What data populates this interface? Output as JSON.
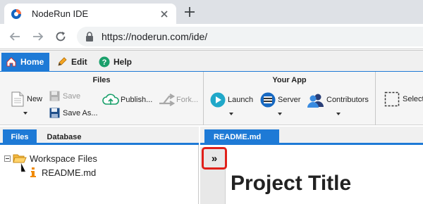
{
  "browser": {
    "tab_title": "NodeRun IDE",
    "url": "https://noderun.com/ide/",
    "icons": [
      "back-arrow-icon",
      "forward-arrow-icon",
      "reload-icon",
      "lock-icon",
      "close-icon",
      "plus-icon"
    ]
  },
  "menubar": {
    "home_label": "Home",
    "edit_label": "Edit",
    "help_label": "Help"
  },
  "ribbon": {
    "files_group": {
      "title": "Files",
      "new_label": "New",
      "save_label": "Save",
      "save_as_label": "Save As...",
      "publish_label": "Publish...",
      "fork_label": "Fork..."
    },
    "app_group": {
      "title": "Your App",
      "launch_label": "Launch",
      "server_label": "Server",
      "contributors_label": "Contributors"
    },
    "select_label": "Select"
  },
  "left_panel": {
    "tabs": [
      "Files",
      "Database"
    ],
    "tree": {
      "root_label": "Workspace Files",
      "file_label": "README.md"
    }
  },
  "editor": {
    "tab_label": "README.md",
    "collapse_label": "»",
    "heading": "Project Title"
  },
  "colors": {
    "accent": "#1e7ad6",
    "highlight_outline": "#e0201a"
  }
}
